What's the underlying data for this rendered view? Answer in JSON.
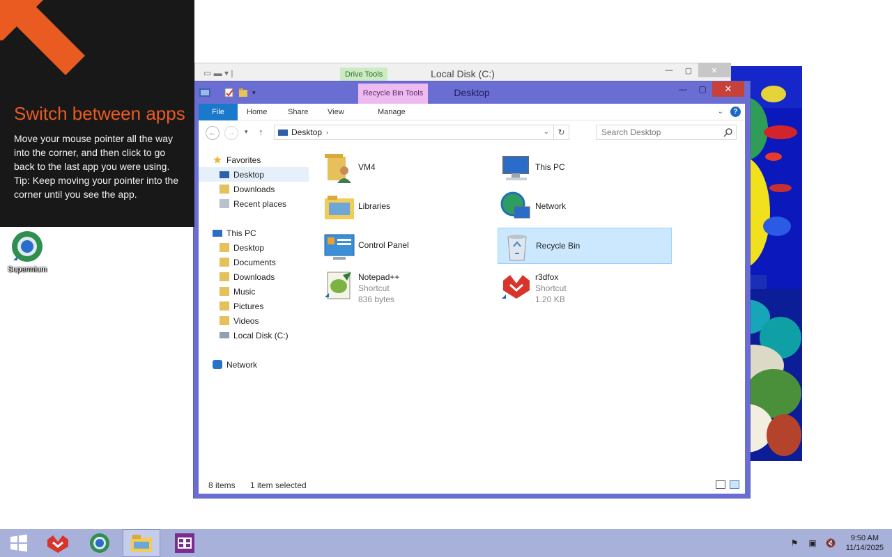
{
  "tip": {
    "heading": "Switch between apps",
    "body_lines": [
      "Move your mouse pointer all the way into the corner, and then click to go back to the last app you were using.",
      "Tip: Keep moving your pointer into the corner until you see the app."
    ]
  },
  "desktop_icons": [
    {
      "label": "Supermium",
      "icon": "supermium-icon"
    }
  ],
  "back_window": {
    "title": "Local Disk (C:)",
    "context_tab": "Drive Tools"
  },
  "window": {
    "title": "Desktop",
    "context_tab": "Recycle Bin Tools",
    "ribbon_tabs": [
      "File",
      "Home",
      "Share",
      "View",
      "Manage"
    ],
    "address_path": "Desktop",
    "search_placeholder": "Search Desktop",
    "nav_pane": [
      {
        "label": "Favorites",
        "icon": "star-icon",
        "level": 0
      },
      {
        "label": "Desktop",
        "icon": "desktop-icon",
        "level": 1,
        "selected": true
      },
      {
        "label": "Downloads",
        "icon": "folder-icon",
        "level": 1
      },
      {
        "label": "Recent places",
        "icon": "recent-places-icon",
        "level": 1
      },
      {
        "label": "This PC",
        "icon": "computer-icon",
        "level": 0
      },
      {
        "label": "Desktop",
        "icon": "folder-icon",
        "level": 1
      },
      {
        "label": "Documents",
        "icon": "folder-icon",
        "level": 1
      },
      {
        "label": "Downloads",
        "icon": "folder-icon",
        "level": 1
      },
      {
        "label": "Music",
        "icon": "folder-icon",
        "level": 1
      },
      {
        "label": "Pictures",
        "icon": "folder-icon",
        "level": 1
      },
      {
        "label": "Videos",
        "icon": "folder-icon",
        "level": 1
      },
      {
        "label": "Local Disk (C:)",
        "icon": "drive-icon",
        "level": 1
      },
      {
        "label": "Network",
        "icon": "network-icon",
        "level": 0
      }
    ],
    "files": [
      {
        "name": "VM4",
        "icon": "user-folder-icon"
      },
      {
        "name": "This PC",
        "icon": "computer-icon"
      },
      {
        "name": "Libraries",
        "icon": "libraries-icon"
      },
      {
        "name": "Network",
        "icon": "network-globe-icon"
      },
      {
        "name": "Control Panel",
        "icon": "control-panel-icon"
      },
      {
        "name": "Recycle Bin",
        "icon": "recycle-bin-icon",
        "selected": true
      },
      {
        "name": "Notepad++",
        "type": "Shortcut",
        "size": "836 bytes",
        "icon": "notepadpp-icon"
      },
      {
        "name": "r3dfox",
        "type": "Shortcut",
        "size": "1.20 KB",
        "icon": "r3dfox-icon"
      }
    ],
    "status": {
      "item_count": "8 items",
      "selection": "1 item selected"
    }
  },
  "taskbar": {
    "apps": [
      "start-icon",
      "r3dfox-icon",
      "supermium-icon",
      "file-explorer-icon",
      "visual-studio-icon"
    ],
    "active_app": "file-explorer-icon",
    "tray_icons": [
      "action-center-icon",
      "network-tray-icon",
      "volume-muted-icon"
    ],
    "time": "9:50 AM",
    "date": "11/14/2025"
  },
  "colors": {
    "window_frame": "#6a6ed2",
    "close_button": "#c7413a",
    "file_tab": "#1979ca",
    "tip_heading": "#ea5b21",
    "selection": "#cce8ff",
    "taskbar": "#a7b1da"
  }
}
